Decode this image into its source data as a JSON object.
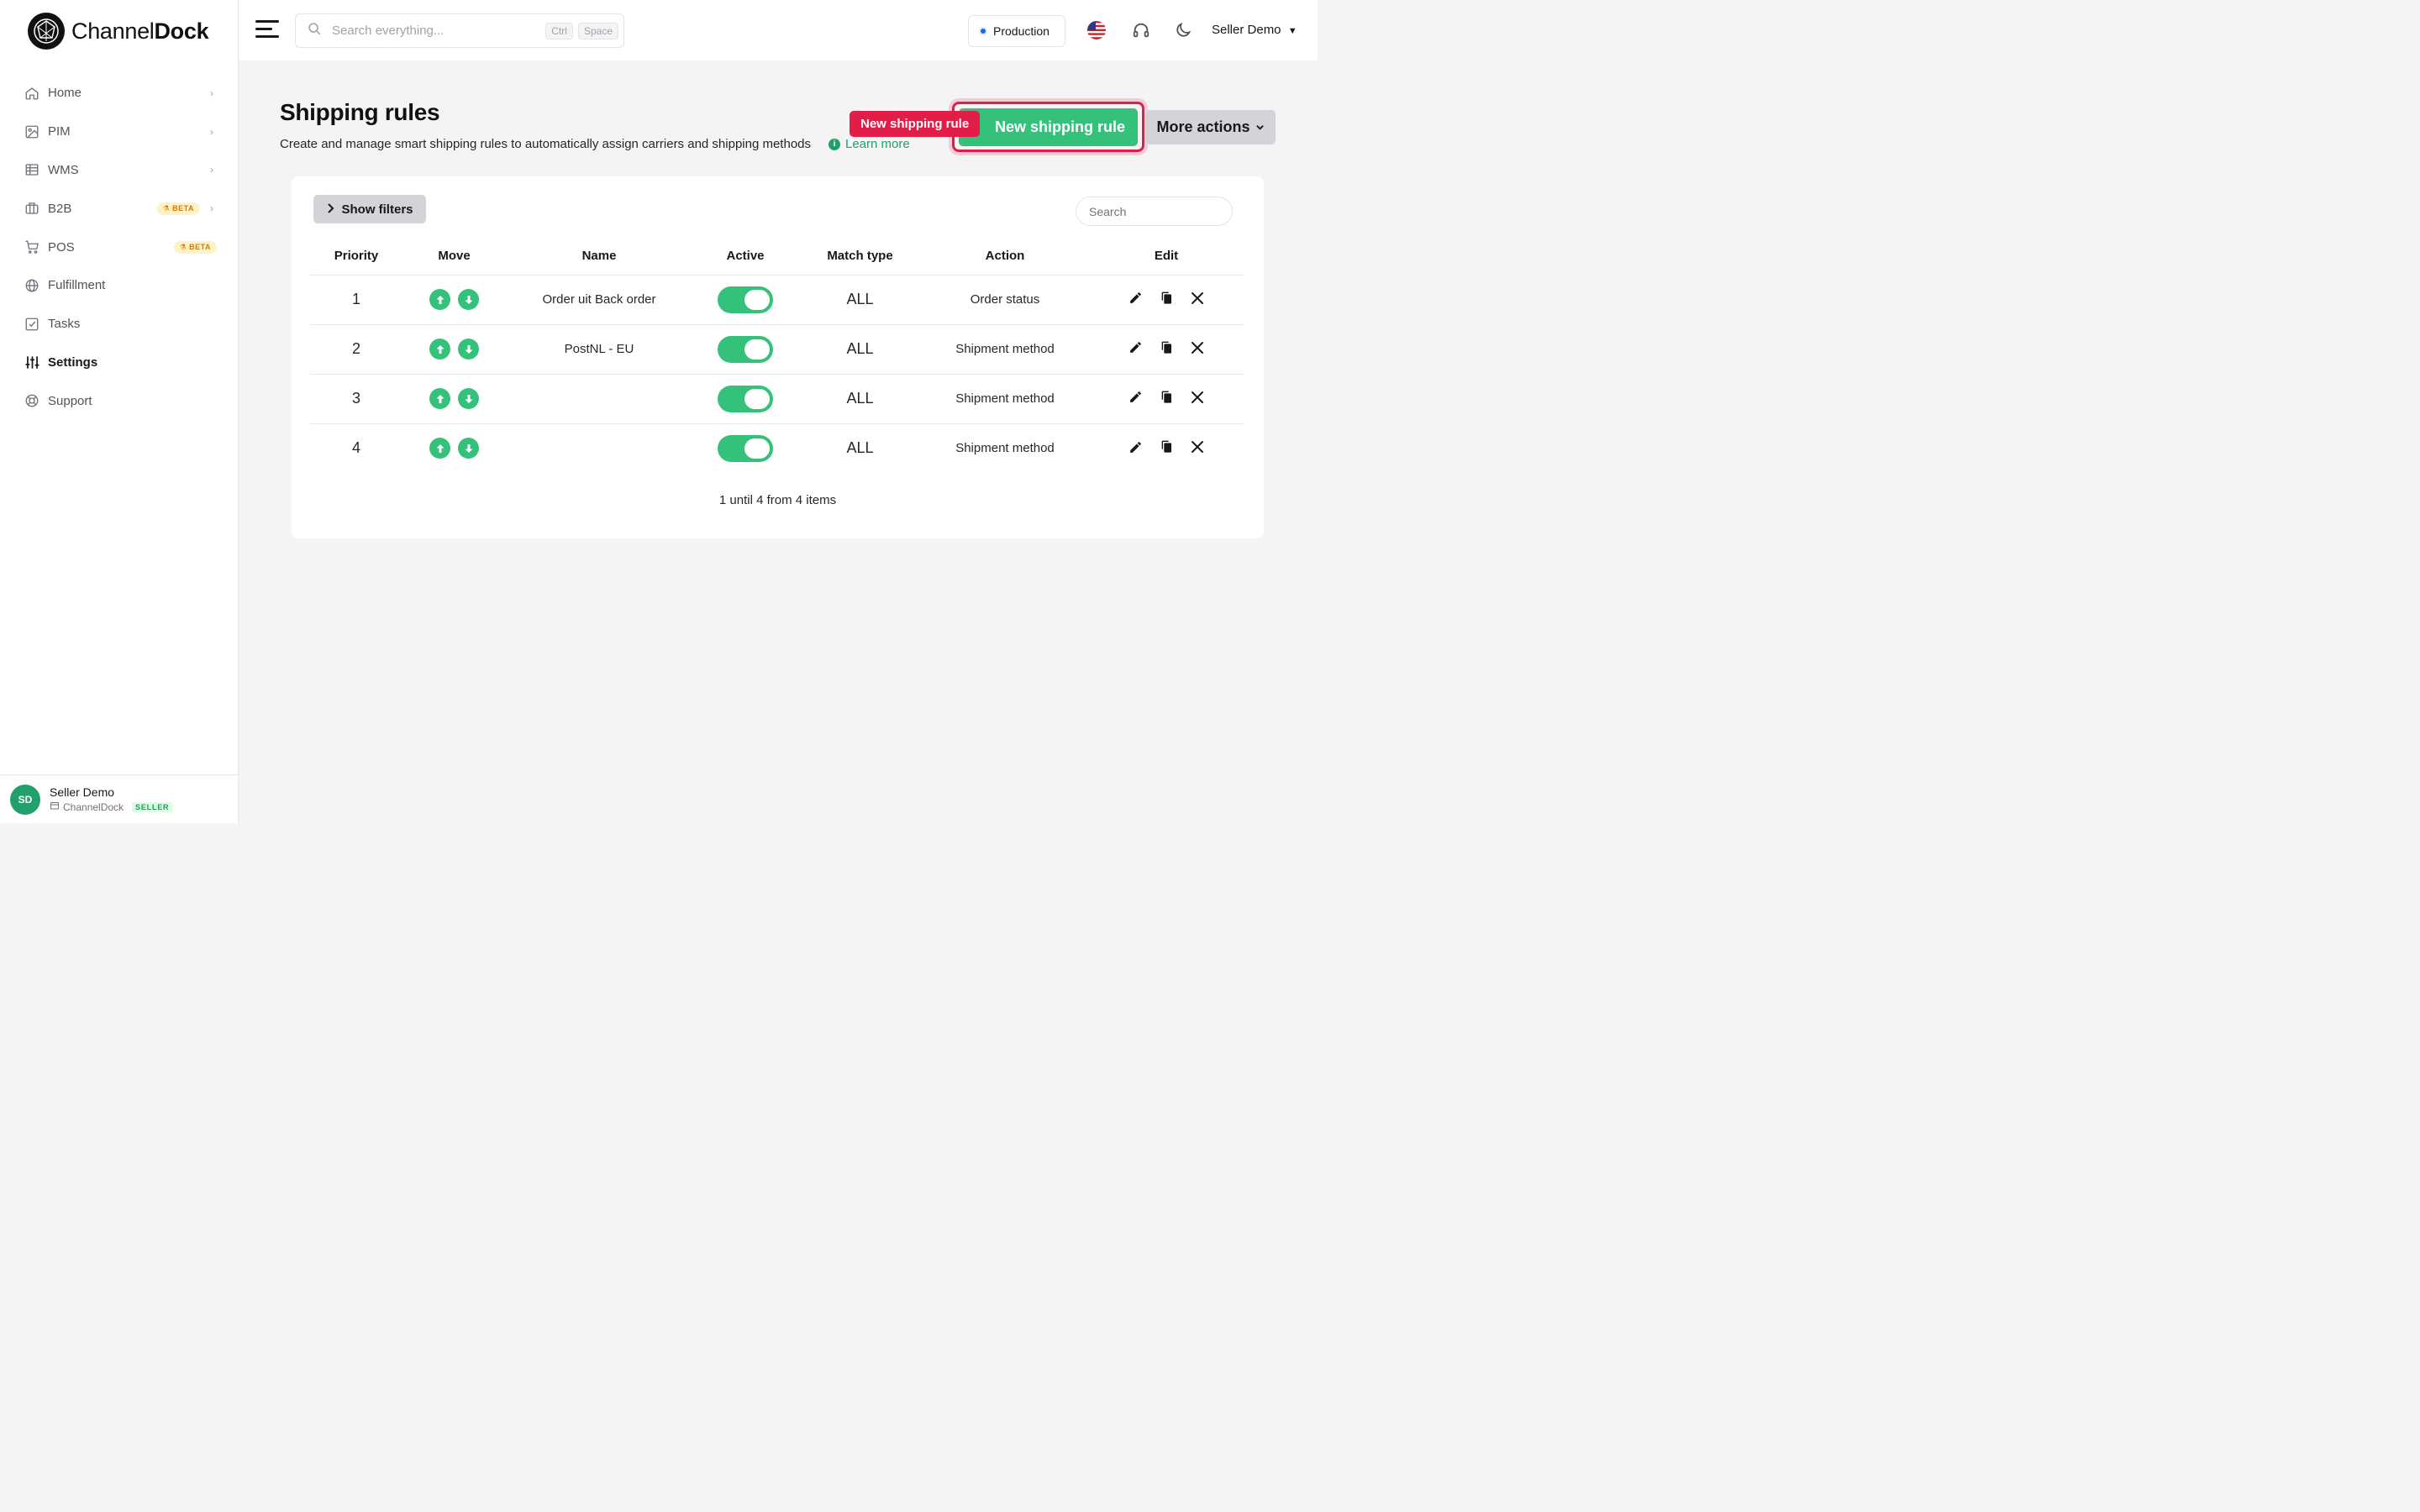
{
  "brand": {
    "name_part1": "Channel",
    "name_part2": "Dock"
  },
  "sidebar": {
    "items": [
      {
        "label": "Home",
        "icon": "home-icon"
      },
      {
        "label": "PIM",
        "icon": "image-icon"
      },
      {
        "label": "WMS",
        "icon": "warehouse-grid-icon"
      },
      {
        "label": "B2B",
        "icon": "briefcase-icon",
        "badge": "BETA"
      },
      {
        "label": "POS",
        "icon": "cart-icon",
        "badge": "BETA"
      },
      {
        "label": "Fulfillment",
        "icon": "globe-icon"
      },
      {
        "label": "Tasks",
        "icon": "checkbox-icon"
      },
      {
        "label": "Settings",
        "icon": "sliders-icon"
      },
      {
        "label": "Support",
        "icon": "lifebuoy-icon"
      }
    ],
    "user": {
      "initials": "SD",
      "name": "Seller Demo",
      "company": "ChannelDock",
      "role": "SELLER"
    }
  },
  "topbar": {
    "search_placeholder": "Search everything...",
    "kbd1": "Ctrl",
    "kbd2": "Space",
    "environment": "Production",
    "user_menu": "Seller Demo"
  },
  "page": {
    "title": "Shipping rules",
    "subtitle": "Create and manage smart shipping rules to automatically assign carriers and shipping methods",
    "learn_more": "Learn more",
    "callout": "New shipping rule",
    "new_button": "New shipping rule",
    "more_actions": "More actions"
  },
  "card": {
    "show_filters": "Show filters",
    "search_placeholder": "Search",
    "columns": [
      "Priority",
      "Move",
      "Name",
      "Active",
      "Match type",
      "Action",
      "Edit"
    ],
    "rows": [
      {
        "priority": "1",
        "name": "Order uit Back order",
        "active": true,
        "match": "ALL",
        "action": "Order status"
      },
      {
        "priority": "2",
        "name": "PostNL - EU",
        "active": true,
        "match": "ALL",
        "action": "Shipment method"
      },
      {
        "priority": "3",
        "name": "",
        "active": true,
        "match": "ALL",
        "action": "Shipment method"
      },
      {
        "priority": "4",
        "name": "",
        "active": true,
        "match": "ALL",
        "action": "Shipment method"
      }
    ],
    "pagination": "1 until 4 from 4 items"
  },
  "colors": {
    "accent": "#34c27a",
    "highlight": "#e11d48"
  }
}
